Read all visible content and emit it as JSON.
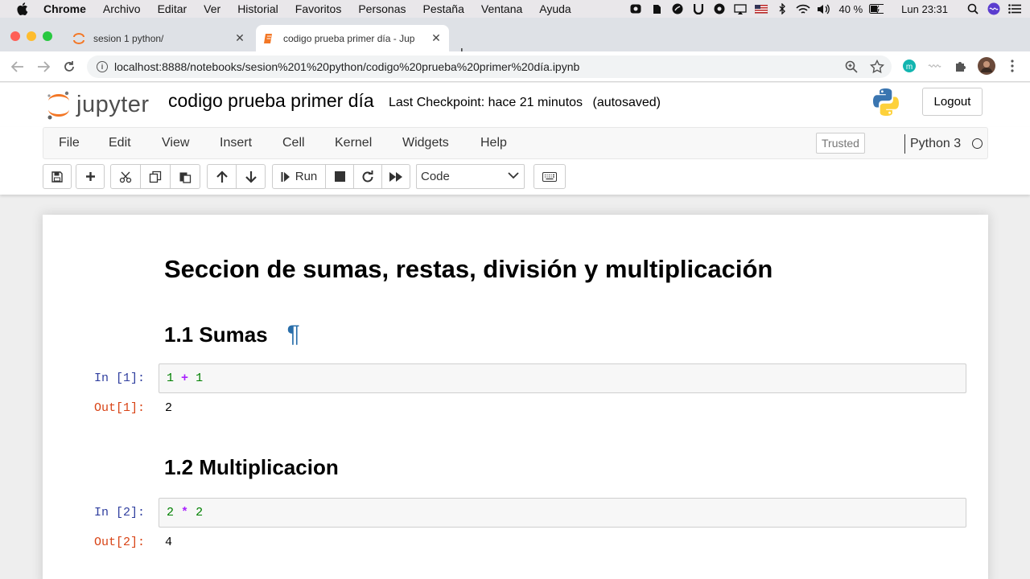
{
  "macbar": {
    "app": "Chrome",
    "menus": [
      "Archivo",
      "Editar",
      "Ver",
      "Historial",
      "Favoritos",
      "Personas",
      "Pestaña",
      "Ventana",
      "Ayuda"
    ],
    "battery": "40 %",
    "clock": "Lun 23:31"
  },
  "tabs": [
    {
      "title": "sesion 1 python/",
      "icon": "jupyter-icon"
    },
    {
      "title": "codigo prueba primer día - Jup",
      "icon": "notebook-icon"
    }
  ],
  "address": {
    "url": "localhost:8888/notebooks/sesion%201%20python/codigo%20prueba%20primer%20día.ipynb"
  },
  "jupyter": {
    "logo_text": "jupyter",
    "notebook_name": "codigo prueba primer día",
    "checkpoint": "Last Checkpoint: hace 21 minutos",
    "autosaved": "(autosaved)",
    "logout": "Logout",
    "menu": [
      "File",
      "Edit",
      "View",
      "Insert",
      "Cell",
      "Kernel",
      "Widgets",
      "Help"
    ],
    "trusted": "Trusted",
    "kernel": "Python 3",
    "run_label": "Run",
    "cell_type": "Code"
  },
  "notebook": {
    "h1": "Seccion de sumas, restas, división y multiplicación",
    "pilcrow": "¶",
    "sections": [
      {
        "heading": "1.1 Sumas",
        "in_prompt": "In [1]:",
        "code": {
          "a": "1",
          "op": "+",
          "b": "1"
        },
        "out_prompt": "Out[1]:",
        "output": "2"
      },
      {
        "heading": "1.2 Multiplicacion",
        "in_prompt": "In [2]:",
        "code": {
          "a": "2",
          "op": "*",
          "b": "2"
        },
        "out_prompt": "Out[2]:",
        "output": "4"
      }
    ]
  },
  "colors": {
    "in_prompt": "#303f9f",
    "out_prompt": "#d84315",
    "number": "#008000",
    "operator": "#aa22ff",
    "pilcrow": "#296eaa"
  }
}
